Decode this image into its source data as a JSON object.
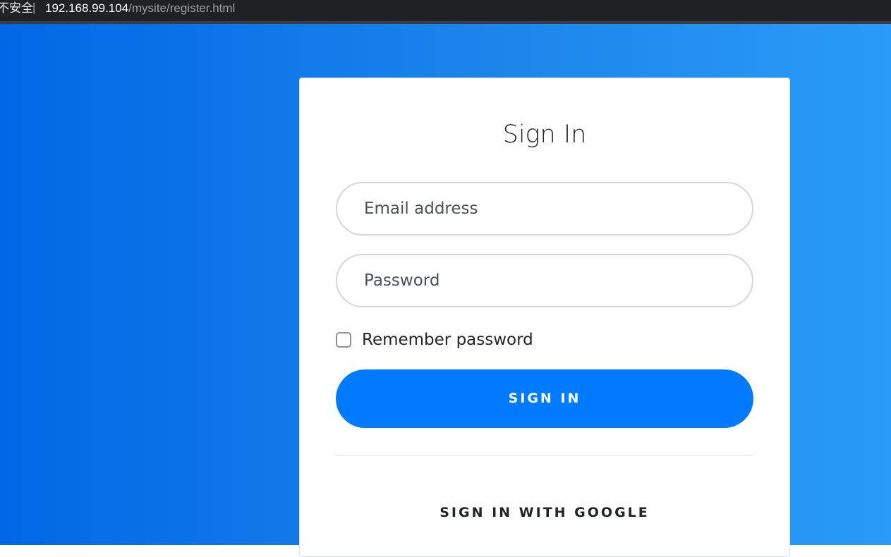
{
  "browser": {
    "security_label": "不安全",
    "separator": "|",
    "url_host": "192.168.99.104",
    "url_path": "/mysite/register.html"
  },
  "colors": {
    "background_start": "#0068e6",
    "background_end": "#2a9bf8",
    "primary_button": "#007bff",
    "card": "#ffffff"
  },
  "form": {
    "title": "Sign In",
    "email_placeholder": "Email address",
    "email_value": "",
    "password_placeholder": "Password",
    "password_value": "",
    "remember_label": "Remember password",
    "remember_checked": false,
    "signin_label": "SIGN IN",
    "google_label": "SIGN IN WITH GOOGLE"
  }
}
